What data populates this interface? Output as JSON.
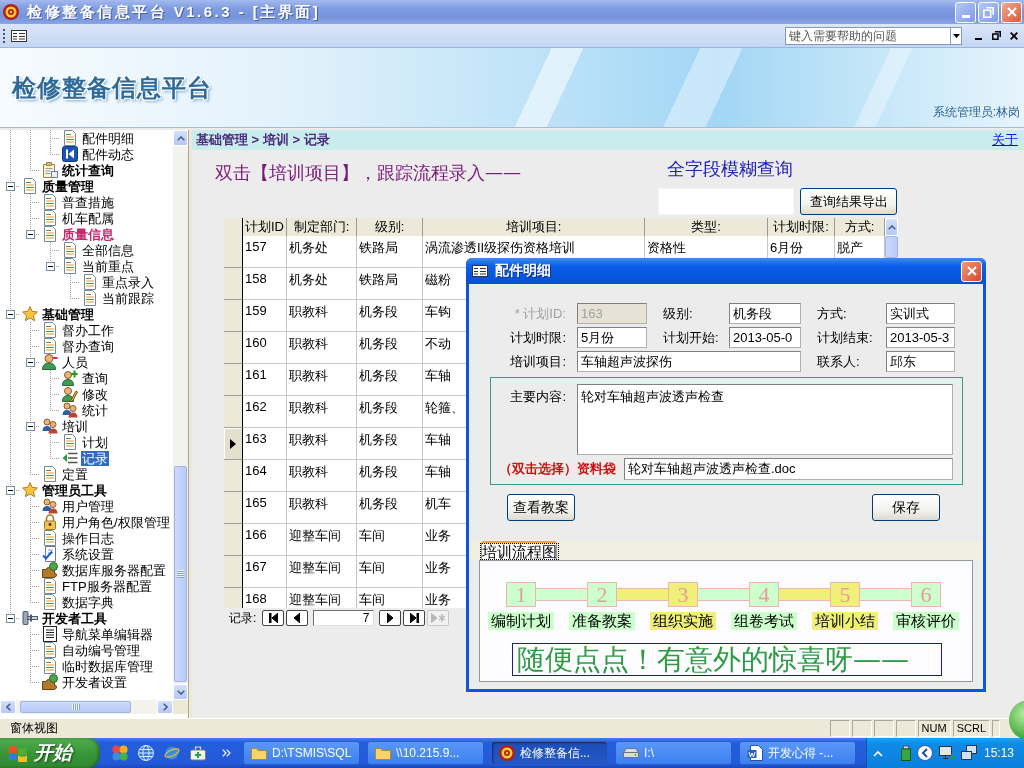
{
  "window": {
    "title": "检修整备信息平台 V1.6.3 - [主界面]"
  },
  "help_box": {
    "placeholder": "键入需要帮助的问题"
  },
  "banner": {
    "title": "检修整备信息平台",
    "user": "系统管理员:林岗"
  },
  "tree": {
    "items": [
      {
        "children": [
          {
            "children": [
              {
                "label": "配件明细",
                "kind": "page",
                "bold": false,
                "highlighted": false,
                "selected": false
              },
              {
                "label": "配件动态",
                "kind": "nav",
                "bold": false,
                "highlighted": false,
                "selected": false
              }
            ]
          },
          {
            "label": "统计查询",
            "kind": "report",
            "bold": true,
            "highlighted": false,
            "selected": false
          }
        ]
      },
      {
        "label": "质量管理",
        "kind": "page",
        "bold": true,
        "highlighted": false,
        "selected": false,
        "expanded": true,
        "children": [
          {
            "label": "普查措施",
            "kind": "page",
            "bold": false,
            "highlighted": false,
            "selected": false
          },
          {
            "label": "机车配属",
            "kind": "page",
            "bold": false,
            "highlighted": false,
            "selected": false
          },
          {
            "label": "质量信息",
            "kind": "page",
            "bold": true,
            "highlighted": true,
            "selected": false,
            "expanded": true,
            "children": [
              {
                "label": "全部信息",
                "kind": "page",
                "bold": false,
                "highlighted": false,
                "selected": false
              },
              {
                "label": "当前重点",
                "kind": "page",
                "bold": false,
                "highlighted": false,
                "selected": false,
                "expanded": true,
                "children": [
                  {
                    "label": "重点录入",
                    "kind": "page",
                    "bold": false,
                    "highlighted": false,
                    "selected": false
                  },
                  {
                    "label": "当前跟踪",
                    "kind": "page",
                    "bold": false,
                    "highlighted": false,
                    "selected": false
                  }
                ]
              }
            ]
          }
        ]
      },
      {
        "label": "基础管理",
        "kind": "star",
        "bold": true,
        "highlighted": false,
        "selected": false,
        "expanded": true,
        "children": [
          {
            "label": "督办工作",
            "kind": "page",
            "bold": false,
            "highlighted": false,
            "selected": false
          },
          {
            "label": "督办查询",
            "kind": "page",
            "bold": false,
            "highlighted": false,
            "selected": false
          },
          {
            "label": "人员",
            "kind": "person",
            "bold": false,
            "highlighted": false,
            "selected": false,
            "expanded": true,
            "children": [
              {
                "label": "查询",
                "kind": "person-add",
                "bold": false,
                "highlighted": false,
                "selected": false
              },
              {
                "label": "修改",
                "kind": "person-edit",
                "bold": false,
                "highlighted": false,
                "selected": false
              },
              {
                "label": "统计",
                "kind": "people",
                "bold": false,
                "highlighted": false,
                "selected": false
              }
            ]
          },
          {
            "label": "培训",
            "kind": "people",
            "bold": false,
            "highlighted": false,
            "selected": false,
            "expanded": true,
            "children": [
              {
                "label": "计划",
                "kind": "page",
                "bold": false,
                "highlighted": false,
                "selected": false
              },
              {
                "label": "记录",
                "kind": "entry",
                "bold": false,
                "highlighted": false,
                "selected": true
              }
            ]
          },
          {
            "label": "定置",
            "kind": "page",
            "bold": false,
            "highlighted": false,
            "selected": false
          }
        ]
      },
      {
        "label": "管理员工具",
        "kind": "star",
        "bold": true,
        "highlighted": false,
        "selected": false,
        "expanded": true,
        "children": [
          {
            "label": "用户管理",
            "kind": "people",
            "bold": false,
            "highlighted": false,
            "selected": false
          },
          {
            "label": "用户角色/权限管理",
            "kind": "lock",
            "bold": false,
            "highlighted": false,
            "selected": false
          },
          {
            "label": "操作日志",
            "kind": "page",
            "bold": false,
            "highlighted": false,
            "selected": false
          },
          {
            "label": "系统设置",
            "kind": "checklist",
            "bold": false,
            "highlighted": false,
            "selected": false
          },
          {
            "label": "数据库服务器配置",
            "kind": "puzzle",
            "bold": false,
            "highlighted": false,
            "selected": false
          },
          {
            "label": "FTP服务器配置",
            "kind": "page",
            "bold": false,
            "highlighted": false,
            "selected": false
          },
          {
            "label": "数据字典",
            "kind": "page",
            "bold": false,
            "highlighted": false,
            "selected": false
          }
        ]
      },
      {
        "label": "开发者工具",
        "kind": "tools",
        "bold": true,
        "highlighted": false,
        "selected": false,
        "expanded": true,
        "children": [
          {
            "label": "导航菜单编辑器",
            "kind": "list",
            "bold": false,
            "highlighted": false,
            "selected": false
          },
          {
            "label": "自动编号管理",
            "kind": "page",
            "bold": false,
            "highlighted": false,
            "selected": false
          },
          {
            "label": "临时数据库管理",
            "kind": "page",
            "bold": false,
            "highlighted": false,
            "selected": false
          },
          {
            "label": "开发者设置",
            "kind": "puzzle",
            "bold": false,
            "highlighted": false,
            "selected": false
          }
        ]
      }
    ]
  },
  "main": {
    "breadcrumb": "基础管理 > 培训 > 记录",
    "about_link": "关于",
    "hint": "双击【培训项目】，跟踪流程录入——",
    "search_label": "全字段模糊查询",
    "export_button": "查询结果导出"
  },
  "table": {
    "columns": [
      "计划ID",
      "制定部门:",
      "级别:",
      "培训项目:",
      "类型:",
      "计划时限:",
      "方式:"
    ],
    "rows": [
      {
        "selected": false,
        "cells": [
          "157",
          "机务处",
          "铁路局",
          "涡流渗透II级探伤资格培训",
          "资格性",
          "6月份",
          "脱产"
        ]
      },
      {
        "selected": false,
        "cells": [
          "158",
          "机务处",
          "铁路局",
          "磁粉"
        ]
      },
      {
        "selected": false,
        "cells": [
          "159",
          "职教科",
          "机务段",
          "车钩"
        ]
      },
      {
        "selected": false,
        "cells": [
          "160",
          "职教科",
          "机务段",
          "不动"
        ]
      },
      {
        "selected": false,
        "cells": [
          "161",
          "职教科",
          "机务段",
          "车轴"
        ]
      },
      {
        "selected": false,
        "cells": [
          "162",
          "职教科",
          "机务段",
          "轮箍、"
        ]
      },
      {
        "selected": true,
        "cells": [
          "163",
          "职教科",
          "机务段",
          "车轴"
        ]
      },
      {
        "selected": false,
        "cells": [
          "164",
          "职教科",
          "机务段",
          "车轴"
        ]
      },
      {
        "selected": false,
        "cells": [
          "165",
          "职教科",
          "机务段",
          "机车"
        ]
      },
      {
        "selected": false,
        "cells": [
          "166",
          "迎整车间",
          "车间",
          "业务"
        ]
      },
      {
        "selected": false,
        "cells": [
          "167",
          "迎整车间",
          "车间",
          "业务"
        ]
      },
      {
        "selected": false,
        "cells": [
          "168",
          "迎整车间",
          "车间",
          "业务"
        ]
      }
    ]
  },
  "record_nav": {
    "label": "记录:",
    "current": "7",
    "buttons": [
      {
        "kind": "first",
        "disabled": false
      },
      {
        "kind": "previous",
        "disabled": false
      },
      {
        "kind": "next",
        "disabled": false
      },
      {
        "kind": "last",
        "disabled": false
      },
      {
        "kind": "new",
        "disabled": true
      }
    ]
  },
  "dialog": {
    "title": "配件明细",
    "fields": {
      "plan_id": {
        "label": "* 计划ID:",
        "value": "163",
        "disabled": true
      },
      "level": {
        "label": "级别:",
        "value": "机务段",
        "disabled": false
      },
      "mode": {
        "label": "方式:",
        "value": "实训式",
        "disabled": false
      },
      "period": {
        "label": "计划时限:",
        "value": "5月份",
        "disabled": false
      },
      "start": {
        "label": "计划开始:",
        "value": "2013-05-0",
        "disabled": false
      },
      "end": {
        "label": "计划结束:",
        "value": "2013-05-3",
        "disabled": false
      },
      "item": {
        "label": "培训项目:",
        "value": "车轴超声波探伤",
        "disabled": false
      },
      "contact": {
        "label": "联系人:",
        "value": "邱东",
        "disabled": false
      }
    },
    "content": {
      "label": "主要内容:",
      "value": "轮对车轴超声波透声检查"
    },
    "attachment": {
      "label": "（双击选择）资料袋",
      "value": "轮对车轴超声波透声检查.doc"
    },
    "buttons": [
      "查看教案",
      "保存"
    ],
    "tabs": [
      {
        "label": "培训流程图",
        "selected": true
      }
    ],
    "steps": [
      {
        "number": "1",
        "label": "编制计划",
        "color": "#ccffcc"
      },
      {
        "number": "2",
        "label": "准备教案",
        "color": "#ccffcc"
      },
      {
        "number": "3",
        "label": "组织实施",
        "color": "#f0f078"
      },
      {
        "number": "4",
        "label": "组卷考试",
        "color": "#ccffcc"
      },
      {
        "number": "5",
        "label": "培训小结",
        "color": "#f0f078"
      },
      {
        "number": "6",
        "label": "审核评价",
        "color": "#ccffcc"
      }
    ],
    "banner": "随便点点！有意外的惊喜呀——"
  },
  "status_bar": {
    "text": "窗体视图",
    "indicators": [
      "NUM",
      "SCRL"
    ]
  },
  "taskbar": {
    "start": "开始",
    "tasks": [
      {
        "label": "D:\\TSMIS\\SQL",
        "kind": "folder",
        "selected": false
      },
      {
        "label": "\\\\10.215.9...",
        "kind": "folder",
        "selected": false
      },
      {
        "label": "检修整备信...",
        "kind": "app",
        "selected": true
      },
      {
        "label": "I:\\",
        "kind": "drive",
        "selected": false
      },
      {
        "label": "开发心得 -...",
        "kind": "document",
        "selected": false
      }
    ],
    "clock": "15:13"
  }
}
